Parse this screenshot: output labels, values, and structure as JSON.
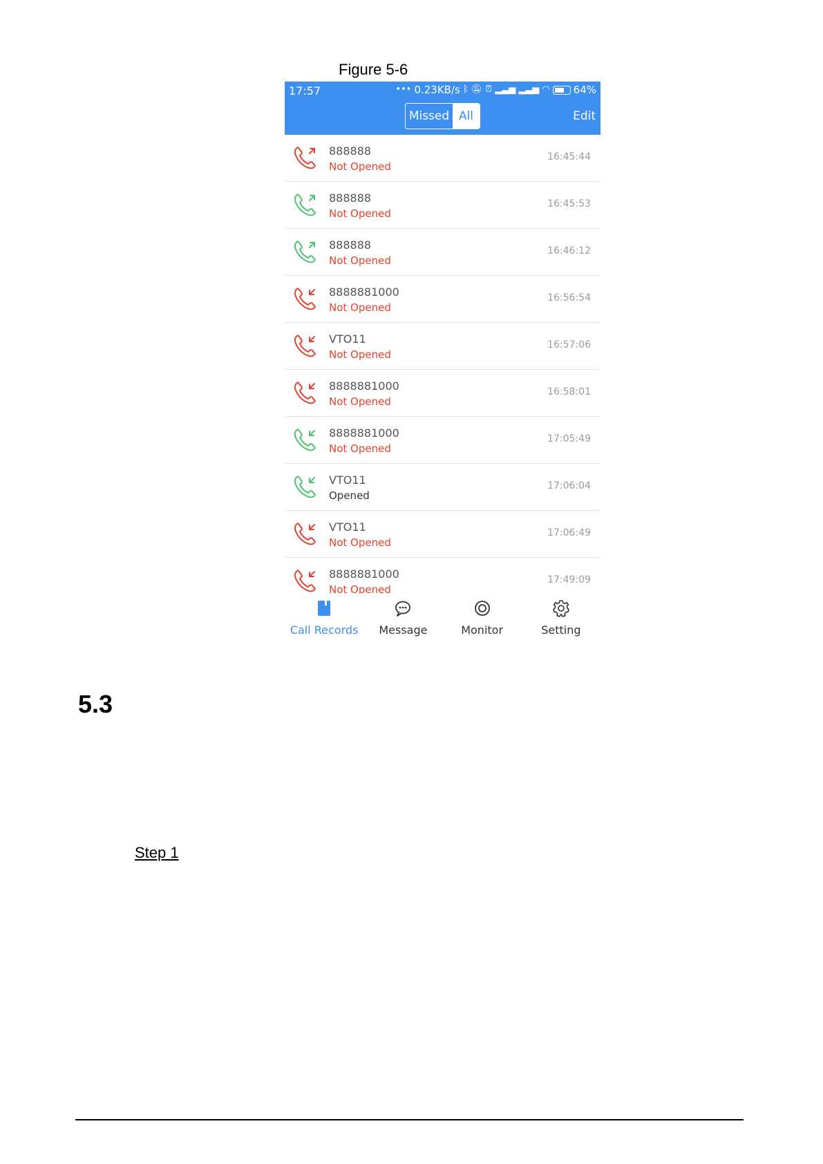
{
  "figure_caption": "Figure 5-6",
  "phone": {
    "status_bar": {
      "time": "17:57",
      "speed": "0.23KB/s",
      "battery": "64%"
    },
    "header": {
      "tab_missed": "Missed",
      "tab_all": "All",
      "edit": "Edit",
      "active_tab": "All"
    },
    "colors": {
      "accent": "#3d8ff0",
      "missed_red": "#e5412c",
      "answered_green": "#4cc46e"
    },
    "records": [
      {
        "name": "888888",
        "status": "Not Opened",
        "time": "16:45:44",
        "direction": "outgoing",
        "color": "red"
      },
      {
        "name": "888888",
        "status": "Not Opened",
        "time": "16:45:53",
        "direction": "outgoing",
        "color": "green"
      },
      {
        "name": "888888",
        "status": "Not Opened",
        "time": "16:46:12",
        "direction": "outgoing",
        "color": "green"
      },
      {
        "name": "8888881000",
        "status": "Not Opened",
        "time": "16:56:54",
        "direction": "incoming",
        "color": "red"
      },
      {
        "name": "VTO11",
        "status": "Not Opened",
        "time": "16:57:06",
        "direction": "incoming",
        "color": "red"
      },
      {
        "name": "8888881000",
        "status": "Not Opened",
        "time": "16:58:01",
        "direction": "incoming",
        "color": "red"
      },
      {
        "name": "8888881000",
        "status": "Not Opened",
        "time": "17:05:49",
        "direction": "incoming",
        "color": "green"
      },
      {
        "name": "VTO11",
        "status": "Opened",
        "time": "17:06:04",
        "direction": "incoming",
        "color": "green"
      },
      {
        "name": "VTO11",
        "status": "Not Opened",
        "time": "17:06:49",
        "direction": "incoming",
        "color": "red"
      },
      {
        "name": "8888881000",
        "status": "Not Opened",
        "time": "17:49:09",
        "direction": "incoming",
        "color": "red"
      }
    ],
    "tabbar": [
      {
        "label": "Call Records",
        "icon": "call-records-icon",
        "active": true
      },
      {
        "label": "Message",
        "icon": "message-icon",
        "active": false
      },
      {
        "label": "Monitor",
        "icon": "monitor-icon",
        "active": false
      },
      {
        "label": "Setting",
        "icon": "gear-icon",
        "active": false
      }
    ]
  },
  "section_number": "5.3",
  "step_label": "Step 1"
}
